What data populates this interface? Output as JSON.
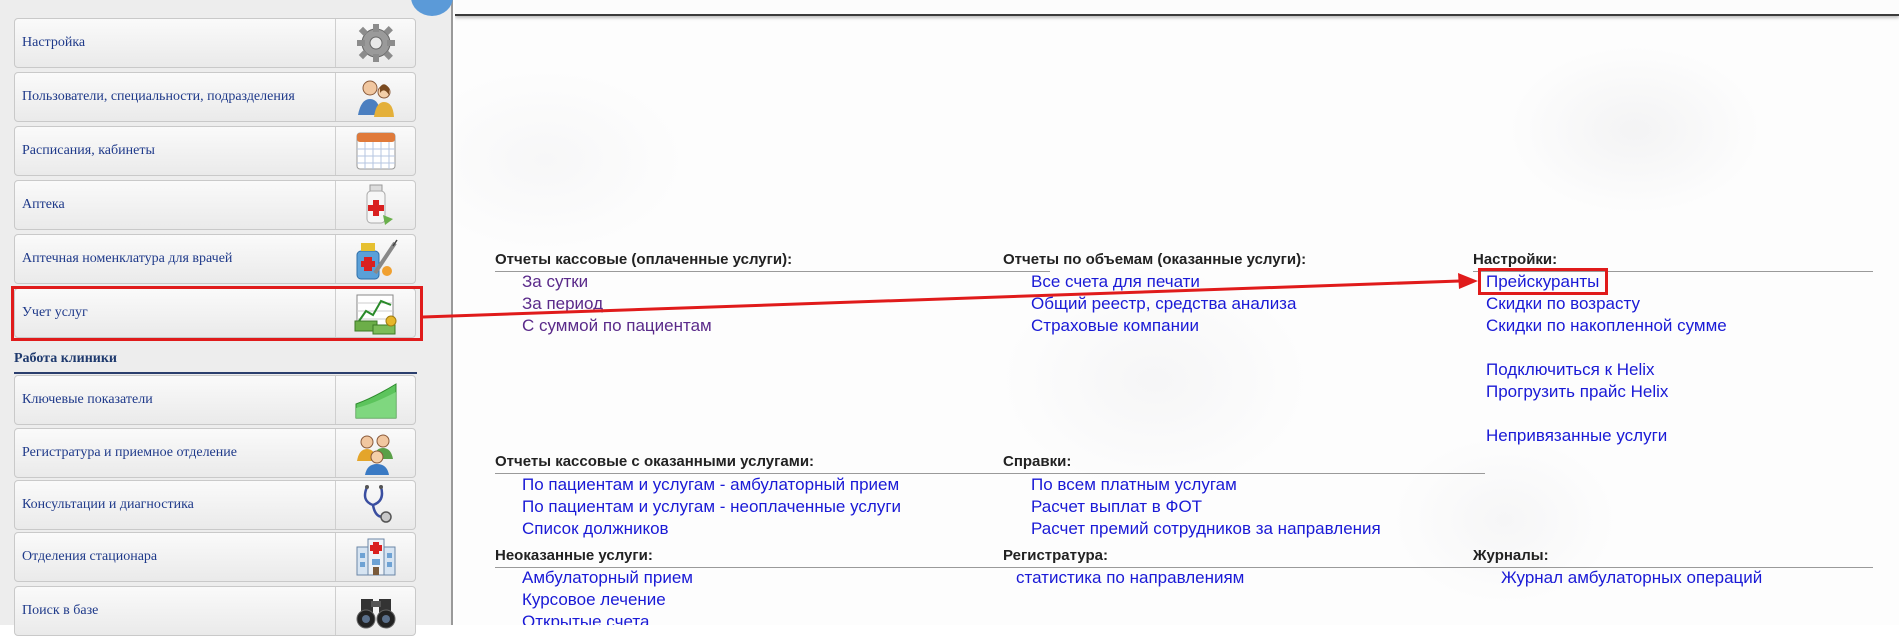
{
  "sidebar": {
    "items": [
      {
        "label": "Настройка",
        "icon": "gear-icon"
      },
      {
        "label": "Пользователи, специальности, подразделения",
        "icon": "users-icon"
      },
      {
        "label": "Расписания, кабинеты",
        "icon": "calendar-icon"
      },
      {
        "label": "Аптека",
        "icon": "medicine-bottle-icon"
      },
      {
        "label": "Аптечная номенклатура для врачей",
        "icon": "syringe-pills-icon"
      },
      {
        "label": "Учет услуг",
        "icon": "chart-money-icon"
      }
    ],
    "section_heading": "Работа клиники",
    "section_items": [
      {
        "label": "Ключевые показатели",
        "icon": "area-chart-icon"
      },
      {
        "label": "Регистратура и приемное отделение",
        "icon": "people-group-icon"
      },
      {
        "label": "Консультации и диагностика",
        "icon": "stethoscope-icon"
      },
      {
        "label": "Отделения стационара",
        "icon": "hospital-building-icon"
      },
      {
        "label": "Поиск в базе",
        "icon": "binoculars-icon"
      }
    ]
  },
  "reports": {
    "cash": {
      "title": "Отчеты кассовые (оплаченные услуги):",
      "links": [
        "За сутки",
        "За период",
        "С суммой по пациентам"
      ]
    },
    "volume": {
      "title": "Отчеты по объемам (оказанные услуги):",
      "links": [
        "Все счета для печати",
        "Общий реестр, средства анализа",
        "Страховые компании"
      ]
    },
    "settings": {
      "title": "Настройки:",
      "links": [
        "Прейскуранты",
        "Скидки по возрасту",
        "Скидки по накопленной сумме",
        "Подключиться к Helix",
        "Прогрузить прайс Helix",
        "Непривязанные услуги"
      ]
    },
    "cash_services": {
      "title": "Отчеты кассовые с оказанными услугами:",
      "links": [
        "По пациентам и услугам - амбулаторный прием",
        "По пациентам и услугам - неоплаченные услуги",
        "Список должников"
      ]
    },
    "refs": {
      "title": "Справки:",
      "links": [
        "По всем платным услугам",
        "Расчет выплат в ФОТ",
        "Расчет премий сотрудников за направления"
      ]
    },
    "unrendered": {
      "title": "Неоказанные услуги:",
      "links": [
        "Амбулаторный прием",
        "Курсовое лечение",
        "Открытые счета"
      ]
    },
    "registry": {
      "title": "Регистратура:",
      "links": [
        "статистика по направлениям"
      ]
    },
    "journals": {
      "title": "Журналы:",
      "links": [
        "Журнал амбулаторных операций"
      ]
    }
  },
  "colors": {
    "link": "#1a1ad6",
    "visited_link": "#5a2a8a",
    "highlight": "#e01b1b",
    "sidebar_text": "#1f3a8a"
  }
}
